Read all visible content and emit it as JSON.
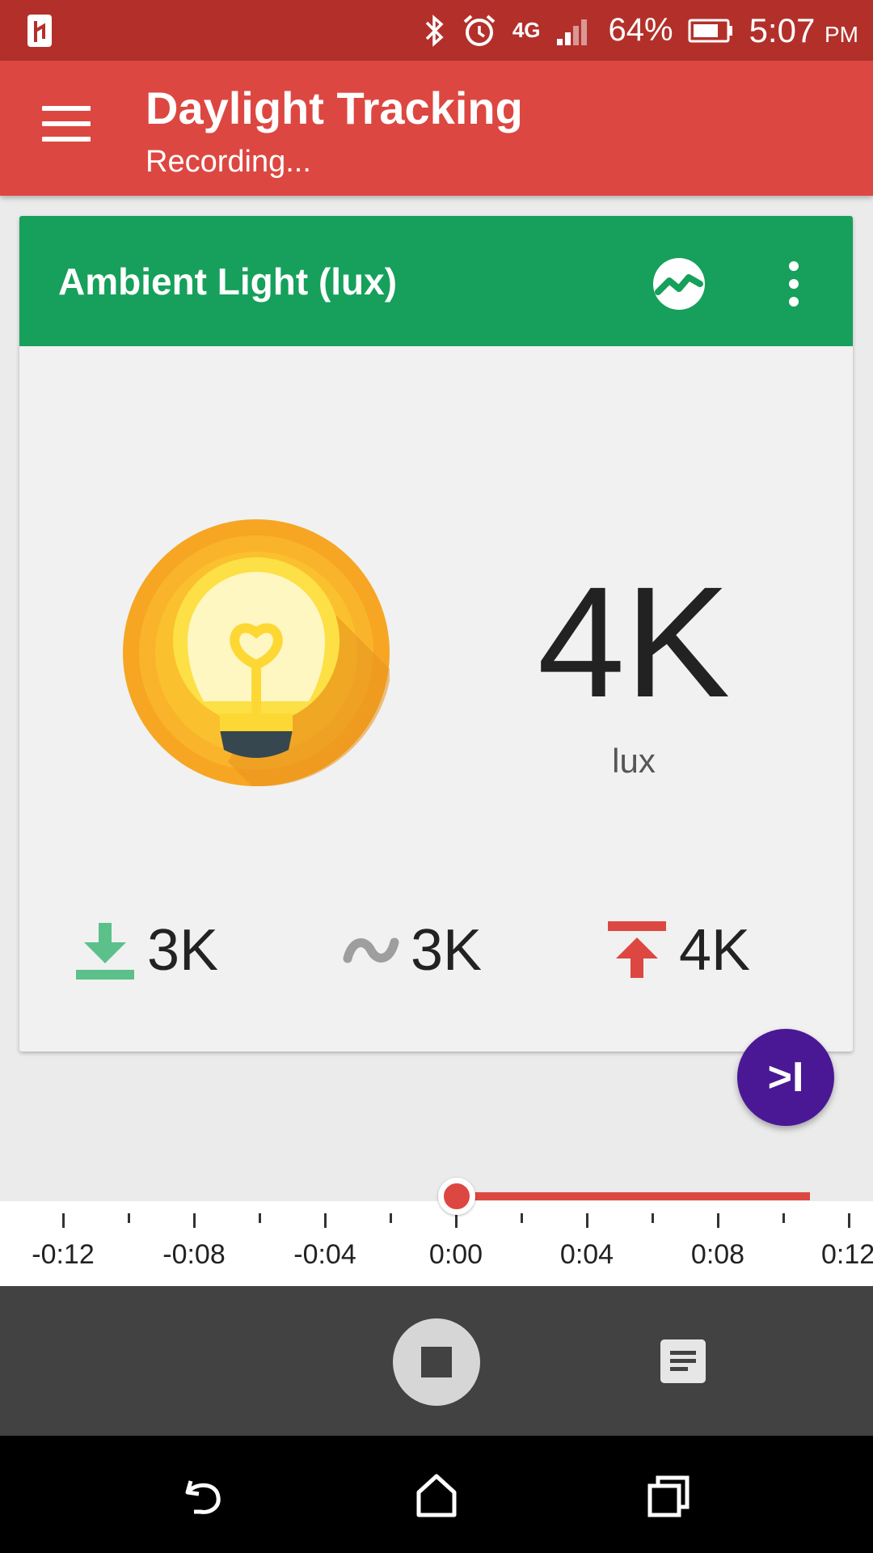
{
  "status_bar": {
    "battery_percent": "64%",
    "time": "5:07",
    "ampm": "PM",
    "network": "4G",
    "icons": [
      "notification-icon",
      "bluetooth-icon",
      "alarm-icon",
      "network-4g-icon",
      "signal-icon",
      "battery-icon"
    ]
  },
  "app_bar": {
    "title": "Daylight Tracking",
    "subtitle": "Recording..."
  },
  "card": {
    "title": "Ambient Light (lux)",
    "value": "4K",
    "unit": "lux",
    "stats": {
      "min": "3K",
      "avg": "3K",
      "max": "4K"
    },
    "icons": [
      "graph-icon",
      "more-vert-icon",
      "lightbulb-icon",
      "min-icon",
      "average-icon",
      "max-icon"
    ]
  },
  "fab": {
    "label": ">I",
    "icon": "skip-to-end-icon"
  },
  "timeline": {
    "labels": [
      "-0:12",
      "-0:08",
      "-0:04",
      "0:00",
      "0:04",
      "0:08",
      "0:12"
    ]
  },
  "controls": {
    "icons": [
      "stop-record-icon",
      "notes-icon"
    ]
  },
  "navigation": {
    "icons": [
      "back-icon",
      "home-icon",
      "recents-icon"
    ]
  },
  "colors": {
    "status_bar": "#b3302a",
    "app_bar": "#dd4741",
    "card_header": "#16a05b",
    "fab": "#4a1894",
    "control_bar": "#424242",
    "min_stat": "#5cc08a",
    "avg_stat": "#9e9e9e",
    "max_stat": "#dd4741"
  }
}
